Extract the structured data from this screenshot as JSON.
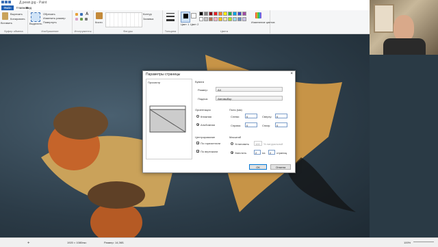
{
  "window": {
    "title": "Д.ремп.jpg - Paint"
  },
  "menu": {
    "file": "Файл",
    "home": "Главная",
    "view": "Вид"
  },
  "ribbon": {
    "clipboard": {
      "paste": "Вставить",
      "cut": "Вырезать",
      "copy": "Копировать",
      "label": "Буфер обмена"
    },
    "image": {
      "select": "Выделить",
      "crop": "Обрезать",
      "resize": "Изменить размер",
      "rotate": "Повернуть",
      "label": "Изображение"
    },
    "tools": {
      "label": "Инструменты"
    },
    "shapes": {
      "brushes": "Кисти",
      "outline": "Контур",
      "fill": "Заливка",
      "label": "Фигуры"
    },
    "size": {
      "label": "Толщина"
    },
    "colors": {
      "color1": "Цвет 1",
      "color2": "Цвет 2",
      "edit": "Изменение цветов",
      "label": "Цвета"
    }
  },
  "palette": [
    "#000000",
    "#7f7f7f",
    "#880015",
    "#ed1c24",
    "#ff7f27",
    "#fff200",
    "#22b14c",
    "#00a2e8",
    "#3f48cc",
    "#a349a4",
    "#ffffff",
    "#c3c3c3",
    "#b97a57",
    "#ffaec9",
    "#ffc90e",
    "#efe4b0",
    "#b5e61d",
    "#99d9ea",
    "#7092be",
    "#c8bfe7"
  ],
  "dialog": {
    "title": "Параметры страницы",
    "preview_label": "Просмотр",
    "paper": {
      "label": "Бумага",
      "size_label": "Размер:",
      "size_value": "A4",
      "source_label": "Подача:",
      "source_value": "Автовыбор"
    },
    "orientation": {
      "label": "Ориентация",
      "portrait": "Книжная",
      "landscape": "Альбомная"
    },
    "margins": {
      "label": "Поля (мм)",
      "left": "Слева:",
      "left_value": "0",
      "top": "Сверху:",
      "top_value": "0",
      "right": "Справа:",
      "right_value": "0",
      "bottom": "Снизу:",
      "bottom_value": "0"
    },
    "centering": {
      "label": "Центрирование",
      "horizontal": "По горизонтали",
      "vertical": "По вертикали"
    },
    "scale": {
      "label": "Масштаб",
      "adjust": "Установить",
      "adjust_value": "100",
      "adjust_unit": "% натуральной",
      "fit": "Уместить",
      "fit_w": "2",
      "by": "на",
      "fit_h": "2",
      "pages": "страниц"
    },
    "ok": "ОК",
    "cancel": "Отмена"
  },
  "status": {
    "dimensions": "1920 × 1080пкс",
    "filesize": "Размер: 14,3КБ",
    "zoom": "100%"
  }
}
